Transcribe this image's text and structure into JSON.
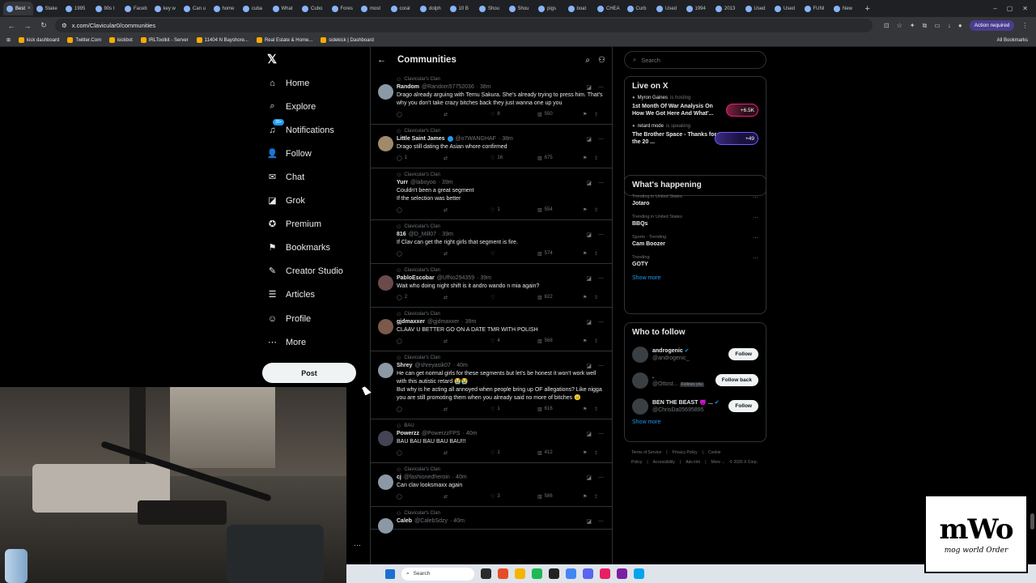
{
  "browser": {
    "tabs": [
      {
        "label": "Best"
      },
      {
        "label": "Stake"
      },
      {
        "label": "1995"
      },
      {
        "label": "90s t"
      },
      {
        "label": "Faceb"
      },
      {
        "label": "key w"
      },
      {
        "label": "Can u"
      },
      {
        "label": "home"
      },
      {
        "label": "cuba"
      },
      {
        "label": "What"
      },
      {
        "label": "Cubo"
      },
      {
        "label": "Fores"
      },
      {
        "label": "most"
      },
      {
        "label": "coral"
      },
      {
        "label": "dolph"
      },
      {
        "label": "10 B"
      },
      {
        "label": "Shou"
      },
      {
        "label": "Shou"
      },
      {
        "label": "pigs"
      },
      {
        "label": "boat"
      },
      {
        "label": "CHEA"
      },
      {
        "label": "Curb"
      },
      {
        "label": "Used"
      },
      {
        "label": "1994"
      },
      {
        "label": "2013"
      },
      {
        "label": "Used"
      },
      {
        "label": "Used"
      },
      {
        "label": "FUNI"
      },
      {
        "label": "New"
      }
    ],
    "url": "x.com/Clavicular0/communities",
    "action_required": "Action required",
    "bookmarks": [
      {
        "label": "kick dashboard"
      },
      {
        "label": "Twitter.Com"
      },
      {
        "label": "kickbot"
      },
      {
        "label": "IRLToolkit - Server"
      },
      {
        "label": "11404 N Bayshore..."
      },
      {
        "label": "Real Estate & Home..."
      },
      {
        "label": "sidekick | Dashboard"
      }
    ],
    "all_bookmarks": "All Bookmarks"
  },
  "nav": {
    "logo": "𝕏",
    "items": [
      {
        "label": "Home",
        "icon": "⌂"
      },
      {
        "label": "Explore",
        "icon": "⌕"
      },
      {
        "label": "Notifications",
        "icon": "♫",
        "badge": "30+"
      },
      {
        "label": "Follow",
        "icon": "👤"
      },
      {
        "label": "Chat",
        "icon": "✉"
      },
      {
        "label": "Grok",
        "icon": "◪"
      },
      {
        "label": "Premium",
        "icon": "✪"
      },
      {
        "label": "Bookmarks",
        "icon": "⚑"
      },
      {
        "label": "Creator Studio",
        "icon": "✎"
      },
      {
        "label": "Articles",
        "icon": "☰"
      },
      {
        "label": "Profile",
        "icon": "☺"
      },
      {
        "label": "More",
        "icon": "⋯"
      }
    ],
    "post": "Post"
  },
  "main": {
    "title": "Communities",
    "tweets": [
      {
        "community": "Clavicular's Clan",
        "name": "Random",
        "handle": "@Random57752036",
        "time": "· 38m",
        "verified": false,
        "text": "Drago already arguing with Temu Sakura. She's already trying to press him. That's why you don't take crazy bitches back they just wanna one up you",
        "replies": "",
        "likes": "8",
        "views": "550",
        "avatar": "#8b98a5"
      },
      {
        "community": "Clavicular's Clan",
        "name": "Little Saint James",
        "handle": "@o7WANGHAF",
        "time": "· 38m",
        "verified": true,
        "text": "Drago still dating the Asian whore confirmed",
        "replies": "1",
        "likes": "16",
        "views": "675",
        "avatar": "#a08a6a"
      },
      {
        "community": "Clavicular's Clan",
        "name": "Yurr",
        "handle": "@laboyoo",
        "time": "· 39m",
        "verified": false,
        "text": "Couldn't been a great segment\nIf the selection was better",
        "replies": "",
        "likes": "1",
        "views": "554",
        "avatar": "#000"
      },
      {
        "community": "Clavicular's Clan",
        "name": "816",
        "handle": "@D_Mill07",
        "time": "· 39m",
        "verified": false,
        "text": "If Clav can get the right girls that segment is fire.",
        "replies": "",
        "likes": "",
        "views": "574",
        "avatar": "#000"
      },
      {
        "community": "Clavicular's Clan",
        "name": "PabloEscobar",
        "handle": "@UfNo294359",
        "time": "· 39m",
        "verified": false,
        "text": "Wait who doing night shift is it andro wando n mia again?",
        "replies": "2",
        "likes": "",
        "views": "622",
        "avatar": "#6a4a4a"
      },
      {
        "community": "Clavicular's Clan",
        "name": "gjdmaxxer",
        "handle": "@gjdmaxxer",
        "time": "· 39m",
        "verified": false,
        "text": "CLAAV U BETTER GO ON A DATE TMR WITH POLISH",
        "replies": "",
        "likes": "4",
        "views": "568",
        "avatar": "#7a5a4a"
      },
      {
        "community": "Clavicular's Clan",
        "name": "Shrey",
        "handle": "@shreyasik07",
        "time": "· 40m",
        "verified": false,
        "text": "He can get normal girls for these segments but let's be honest it won't work well with this autistic retard 😭😭\nBut why is he acting all annoyed when people bring up OF allegations? Like nigga you are still promoting them when you already said no more of bitches 😐",
        "replies": "",
        "likes": "1",
        "views": "616",
        "avatar": "#8b98a5"
      },
      {
        "community": "BAU",
        "name": "Powerzz",
        "handle": "@PowerzzFPS",
        "time": "· 40m",
        "verified": false,
        "text": "BAU BAU BAU BAU BAU!!!",
        "replies": "",
        "likes": "1",
        "views": "412",
        "avatar": "#445"
      },
      {
        "community": "Clavicular's Clan",
        "name": "cj",
        "handle": "@fashionedheroin",
        "time": "· 40m",
        "verified": false,
        "text": "Can clav looksmaxx again",
        "replies": "",
        "likes": "3",
        "views": "586",
        "avatar": "#8b98a5"
      },
      {
        "community": "Clavicular's Clan",
        "name": "Caleb",
        "handle": "@CalebSdzy",
        "time": "· 40m",
        "verified": false,
        "text": "",
        "replies": "",
        "likes": "",
        "views": "",
        "avatar": "#8b98a5"
      }
    ]
  },
  "right": {
    "search_placeholder": "Search",
    "live": {
      "title": "Live on X",
      "items": [
        {
          "host": "Myron Gaines",
          "status": "is hosting",
          "title": "1st Month Of War Analysis On How We Got Here And What'...",
          "count": "+6.5K",
          "style": "pink"
        },
        {
          "host": "retard mode",
          "status": "is speaking",
          "title": "The Brother Space - Thanks for the 20 ...",
          "count": "+49",
          "style": "purple"
        }
      ]
    },
    "happening": {
      "title": "What's happening",
      "trends": [
        {
          "meta": "Trending in United States",
          "name": "Jotaro"
        },
        {
          "meta": "Trending in United States",
          "name": "BBQs"
        },
        {
          "meta": "Sports · Trending",
          "name": "Cam Boozer"
        },
        {
          "meta": "Trending",
          "name": "GOTY"
        }
      ],
      "show_more": "Show more"
    },
    "who_to_follow": {
      "title": "Who to follow",
      "users": [
        {
          "name": "androgenic",
          "handle": "@androgenic_",
          "verified": true,
          "follows_you": "",
          "button": "Follow"
        },
        {
          "name": ".",
          "handle": "@Ottost...",
          "verified": false,
          "follows_you": "Follows you",
          "button": "Follow back"
        },
        {
          "name": "BEN THE BEAST 😈 ...",
          "handle": "@ChrisDa05695895",
          "verified": true,
          "follows_you": "",
          "button": "Follow"
        }
      ],
      "show_more": "Show more"
    },
    "footer": [
      "Terms of Service",
      "|",
      "Privacy Policy",
      "|",
      "Cookie Policy",
      "|",
      "Accessibility",
      "|",
      "Ads info",
      "|",
      "More ...",
      "© 2026 X Corp."
    ]
  },
  "taskbar": {
    "search": "Search"
  },
  "watermark": {
    "big": "mWo",
    "sub": "mog world Order"
  }
}
